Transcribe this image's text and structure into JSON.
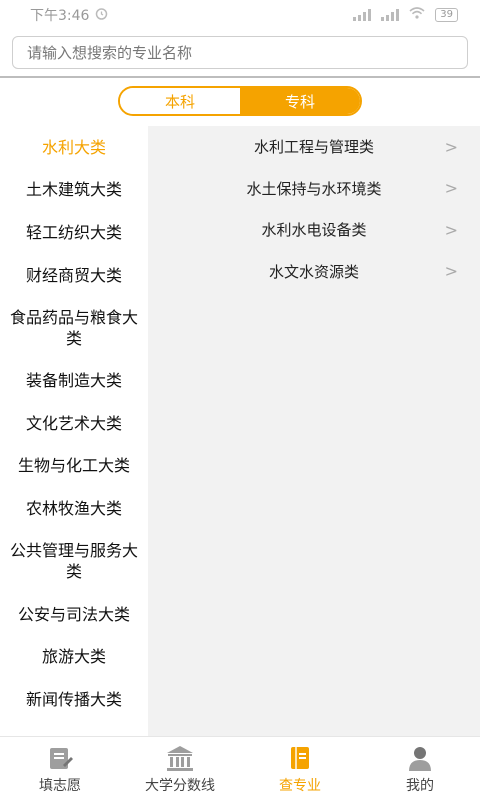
{
  "status_bar": {
    "time": "下午3:46",
    "battery": "39",
    "accent": "#999999"
  },
  "search": {
    "placeholder": "请输入想搜索的专业名称",
    "value": ""
  },
  "segment": {
    "options": [
      {
        "label": "本科",
        "active": false
      },
      {
        "label": "专科",
        "active": true
      }
    ]
  },
  "categories": [
    {
      "label": "水利大类",
      "active": true
    },
    {
      "label": "土木建筑大类",
      "active": false
    },
    {
      "label": "轻工纺织大类",
      "active": false
    },
    {
      "label": "财经商贸大类",
      "active": false
    },
    {
      "label": "食品药品与粮食大类",
      "active": false
    },
    {
      "label": "装备制造大类",
      "active": false
    },
    {
      "label": "文化艺术大类",
      "active": false
    },
    {
      "label": "生物与化工大类",
      "active": false
    },
    {
      "label": "农林牧渔大类",
      "active": false
    },
    {
      "label": "公共管理与服务大类",
      "active": false
    },
    {
      "label": "公安与司法大类",
      "active": false
    },
    {
      "label": "旅游大类",
      "active": false
    },
    {
      "label": "新闻传播大类",
      "active": false
    }
  ],
  "subcategories": [
    {
      "label": "水利工程与管理类"
    },
    {
      "label": "水土保持与水环境类"
    },
    {
      "label": "水利水电设备类"
    },
    {
      "label": "水文水资源类"
    }
  ],
  "bottom_nav": [
    {
      "label": "填志愿",
      "icon": "form-icon",
      "active": false
    },
    {
      "label": "大学分数线",
      "icon": "university-icon",
      "active": false
    },
    {
      "label": "查专业",
      "icon": "book-icon",
      "active": true
    },
    {
      "label": "我的",
      "icon": "profile-icon",
      "active": false
    }
  ],
  "colors": {
    "accent": "#f5a300",
    "panel_bg": "#f2f2f2"
  }
}
